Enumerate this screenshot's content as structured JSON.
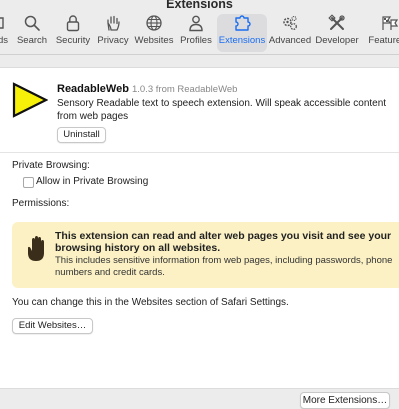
{
  "window": {
    "title": "Extensions"
  },
  "tabs": [
    {
      "label": "ds",
      "icon": "partial-icon"
    },
    {
      "label": "Search",
      "icon": "search-icon"
    },
    {
      "label": "Security",
      "icon": "lock-icon"
    },
    {
      "label": "Privacy",
      "icon": "hand-icon"
    },
    {
      "label": "Websites",
      "icon": "globe-icon"
    },
    {
      "label": "Profiles",
      "icon": "person-icon"
    },
    {
      "label": "Extensions",
      "icon": "puzzle-icon",
      "active": true
    },
    {
      "label": "Advanced",
      "icon": "gears-icon"
    },
    {
      "label": "Developer",
      "icon": "tools-icon"
    },
    {
      "label": "Feature F",
      "icon": "flags-icon"
    }
  ],
  "extension": {
    "name": "ReadableWeb",
    "version_meta": "1.0.3 from ReadableWeb",
    "description": "Sensory Readable text to speech extension. Will speak accessible content from web pages",
    "uninstall_label": "Uninstall",
    "icon": "yellow-play-triangle-icon"
  },
  "private_browsing": {
    "heading": "Private Browsing:",
    "checkbox_label": "Allow in Private Browsing",
    "checked": false
  },
  "permissions": {
    "heading": "Permissions:",
    "warning_title": "This extension can read and alter web pages you visit and see your browsing history on all websites.",
    "warning_body": "This includes sensitive information from web pages, including passwords, phone numbers and credit cards.",
    "warning_color": "#fbf1c4"
  },
  "websites_note": "You can change this in the Websites section of Safari Settings.",
  "edit_websites_label": "Edit Websites…",
  "more_extensions_label": "More Extensions…",
  "colors": {
    "accent": "#1a6df0",
    "background": "#ececec",
    "panel": "#ffffff"
  }
}
